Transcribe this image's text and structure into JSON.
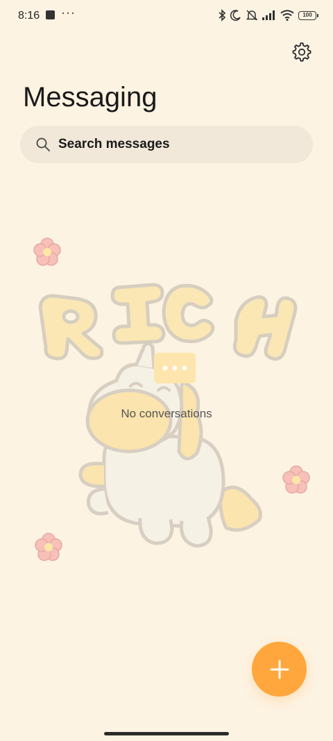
{
  "status_bar": {
    "time": "8:16",
    "more": "···",
    "battery": "100",
    "icons": [
      "bluetooth-icon",
      "moon-icon",
      "bell-muted-icon",
      "signal-icon",
      "wifi-icon",
      "battery-icon"
    ]
  },
  "header": {
    "title": "Messaging",
    "settings_icon": "gear-icon"
  },
  "search": {
    "placeholder": "Search messages",
    "icon": "search-icon"
  },
  "empty_state": {
    "text": "No conversations",
    "illustration_text": "RICH"
  },
  "fab": {
    "icon": "plus-icon",
    "color": "#ffa63c"
  },
  "colors": {
    "background": "#fdf3e2",
    "search_background": "#f1e8d9",
    "accent": "#ffa63c"
  }
}
